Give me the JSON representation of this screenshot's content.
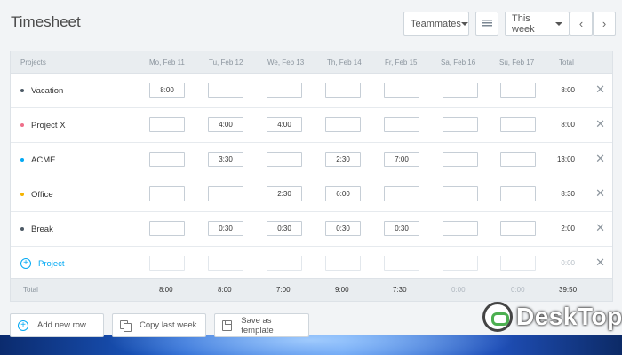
{
  "app": {
    "title": "Timesheet"
  },
  "toolbar": {
    "teammates_label": "Teammates",
    "week_label": "This week",
    "prev_label": "‹",
    "next_label": "›"
  },
  "table": {
    "headers": {
      "projects": "Projects",
      "days": [
        "Mo, Feb 11",
        "Tu, Feb 12",
        "We, Feb 13",
        "Th, Feb 14",
        "Fr, Feb 15",
        "Sa, Feb 16",
        "Su, Feb 17"
      ],
      "total": "Total"
    },
    "rows": [
      {
        "name": "Vacation",
        "color": "#4d5a66",
        "cells": [
          "8:00",
          "",
          "",
          "",
          "",
          "",
          ""
        ],
        "total": "8:00"
      },
      {
        "name": "Project X",
        "color": "#ef6f8a",
        "cells": [
          "",
          "4:00",
          "4:00",
          "",
          "",
          "",
          ""
        ],
        "total": "8:00"
      },
      {
        "name": "ACME",
        "color": "#03a9f4",
        "cells": [
          "",
          "3:30",
          "",
          "2:30",
          "7:00",
          "",
          ""
        ],
        "total": "13:00"
      },
      {
        "name": "Office",
        "color": "#f5b400",
        "cells": [
          "",
          "",
          "2:30",
          "6:00",
          "",
          "",
          ""
        ],
        "total": "8:30"
      },
      {
        "name": "Break",
        "color": "#4d5a66",
        "cells": [
          "",
          "0:30",
          "0:30",
          "0:30",
          "0:30",
          "",
          ""
        ],
        "total": "2:00"
      }
    ],
    "new_row": {
      "label": "Project",
      "total": "0:00"
    },
    "footer": {
      "label": "Total",
      "days": [
        "8:00",
        "8:00",
        "7:00",
        "9:00",
        "7:30",
        "0:00",
        "0:00"
      ],
      "total": "39:50"
    }
  },
  "actions": {
    "add_row": "Add new row",
    "copy_week": "Copy last week",
    "save_template": "Save as template"
  },
  "watermark": {
    "text": "DeskTop"
  }
}
